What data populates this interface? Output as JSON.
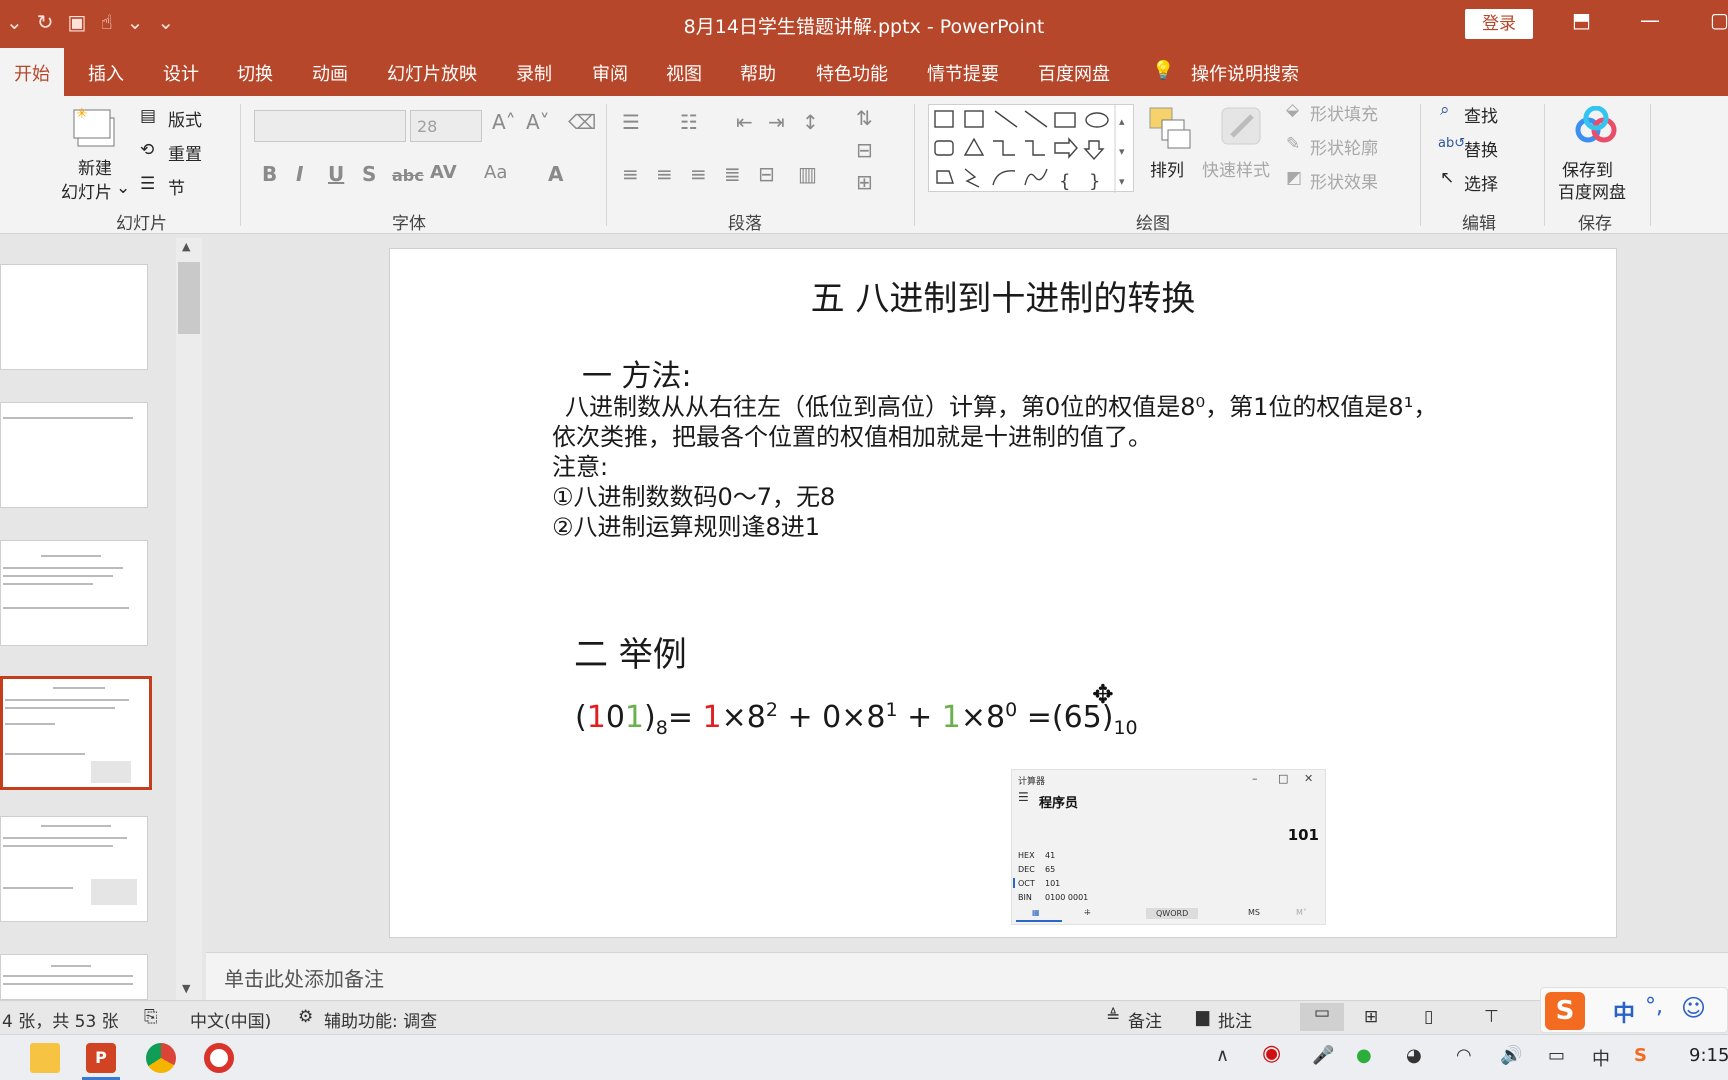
{
  "titlebar": {
    "doc_title": "8月14日学生错题讲解.pptx  -  PowerPoint",
    "login": "登录"
  },
  "tabs": [
    "开始",
    "插入",
    "设计",
    "切换",
    "动画",
    "幻灯片放映",
    "录制",
    "审阅",
    "视图",
    "帮助",
    "特色功能",
    "情节提要",
    "百度网盘",
    "操作说明搜索"
  ],
  "ribbon": {
    "slides": {
      "new_slide_1": "新建",
      "new_slide_2": "幻灯片",
      "layout": "版式",
      "reset": "重置",
      "section": "节",
      "group": "幻灯片"
    },
    "font": {
      "size": "28",
      "group": "字体"
    },
    "paragraph": {
      "group": "段落"
    },
    "drawing": {
      "arrange": "排列",
      "quick_styles": "快速样式",
      "shape_fill": "形状填充",
      "shape_outline": "形状轮廓",
      "shape_effects": "形状效果",
      "group": "绘图"
    },
    "editing": {
      "find": "查找",
      "replace": "替换",
      "select": "选择",
      "group": "编辑"
    },
    "save": {
      "label_1": "保存到",
      "label_2": "百度网盘",
      "group": "保存"
    }
  },
  "slide": {
    "title": "五 八进制到十进制的转换",
    "section1": "一 方法:",
    "line1": "八进制数从从右往左（低位到高位）计算，第0位的权值是8⁰，第1位的权值是8¹，",
    "line2": "依次类推，把最各个位置的权值相加就是十进制的值了。",
    "line3": "注意:",
    "line4": "①八进制数数码0～7，无8",
    "line5": "②八进制运算规则逢8进1",
    "section2": "二 举例",
    "formula": {
      "open": "(",
      "d1": "1",
      "d2": "0",
      "d3": "1",
      "close": ")",
      "base8": "8",
      "eq": "= ",
      "t1": "1",
      "t1b": "×8",
      "t1e": "2",
      "plus1": " + 0×8",
      "t2e": "1",
      "plus2": " + ",
      "t3": "1",
      "t3b": "×8",
      "t3e": "0",
      "result": "  =(65)",
      "base10": "10"
    }
  },
  "calculator": {
    "title": "计算器",
    "mode": "程序员",
    "value": "101",
    "rows": [
      {
        "label": "HEX",
        "value": "41"
      },
      {
        "label": "DEC",
        "value": "65"
      },
      {
        "label": "OCT",
        "value": "101"
      },
      {
        "label": "BIN",
        "value": "0100 0001"
      }
    ],
    "word_size": "QWORD",
    "ms": "MS",
    "m": "M˅"
  },
  "notes_placeholder": "单击此处添加备注",
  "status": {
    "slide_count": "4 张，共 53 张",
    "language": "中文(中国)",
    "accessibility": "辅助功能: 调查",
    "notes": "备注",
    "comments": "批注"
  },
  "tray": {
    "ime": "中",
    "time": "9:15"
  },
  "colors": {
    "accent": "#b7472a",
    "selected_thumb": "#c43e1c",
    "digit_red": "#e02020",
    "digit_green": "#6ab04c"
  }
}
